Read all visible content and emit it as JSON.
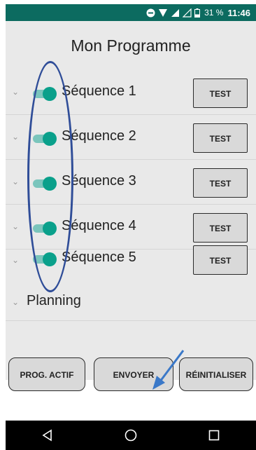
{
  "status_bar": {
    "battery": "31 %",
    "time": "11:46",
    "icons": [
      "minus-circle-icon",
      "data-saver-icon",
      "signal-icon",
      "signal-empty-icon",
      "battery-icon"
    ]
  },
  "header": {
    "title": "Mon Programme"
  },
  "sequences": [
    {
      "label": "Séquence 1",
      "enabled": true,
      "test_label": "TEST"
    },
    {
      "label": "Séquence 2",
      "enabled": true,
      "test_label": "TEST"
    },
    {
      "label": "Séquence 3",
      "enabled": true,
      "test_label": "TEST"
    },
    {
      "label": "Séquence 4",
      "enabled": true,
      "test_label": "TEST"
    },
    {
      "label": "Séquence 5",
      "enabled": true,
      "test_label": "TEST"
    }
  ],
  "planning": {
    "label": "Planning"
  },
  "actions": {
    "prog_actif": "PROG. ACTIF",
    "envoyer": "ENVOYER",
    "reinitialiser": "RÉINITIALISER"
  },
  "nav": {
    "icons": [
      "back-icon",
      "home-icon",
      "recents-icon"
    ]
  },
  "colors": {
    "status_bar": "#0c6b60",
    "switch_on": "#0aa08b",
    "annotation": "#2f4d98"
  }
}
